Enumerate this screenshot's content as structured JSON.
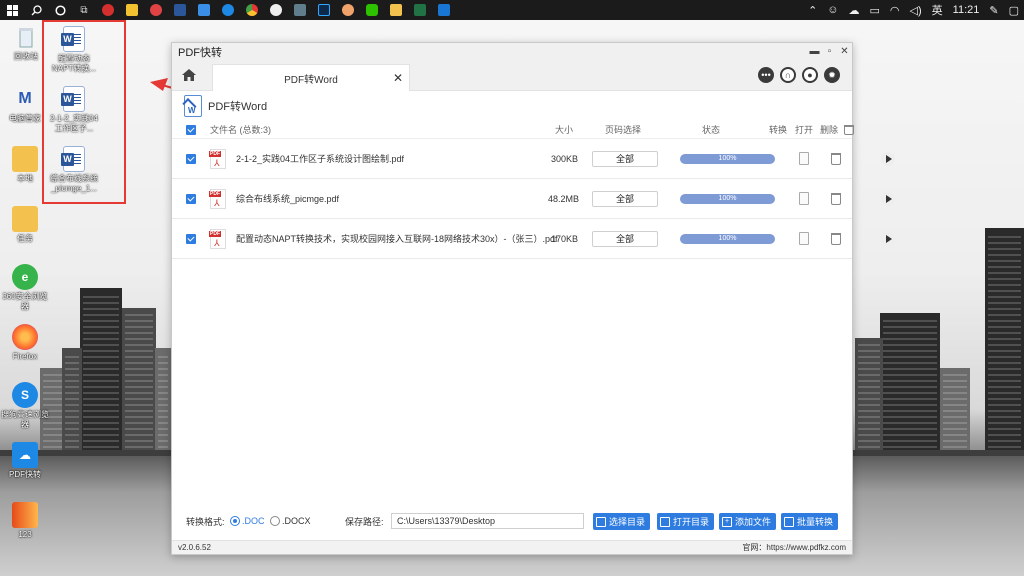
{
  "taskbar": {
    "right": {
      "lang": "英",
      "time": "11:21"
    }
  },
  "desktop_icons": [
    {
      "label": "回收站",
      "icon": "recycle-bin-icon"
    },
    {
      "label": "电脑管家",
      "icon": "pc-manager-icon"
    },
    {
      "label": "本地",
      "icon": "folder-icon"
    },
    {
      "label": "任务",
      "icon": "folder-icon"
    },
    {
      "label": "360安全浏览器",
      "icon": "browser-360-icon"
    },
    {
      "label": "Firefox",
      "icon": "firefox-icon"
    },
    {
      "label": "搜狗高速浏览器",
      "icon": "sogou-browser-icon"
    },
    {
      "label": "PDF快转",
      "icon": "cloud-pdf-icon"
    },
    {
      "label": "123",
      "icon": "folder-icon"
    }
  ],
  "desktop_files": [
    {
      "label": "配置动态NAPT转换..."
    },
    {
      "label": "2-1-2_实践04工作区子..."
    },
    {
      "label": "综合布线系统_picmge_1..."
    }
  ],
  "window": {
    "title": "PDF快转",
    "tab_label": "PDF转Word",
    "section_title": "PDF转Word",
    "columns": {
      "filename": "文件名 (总数:3)",
      "size": "大小",
      "pages": "页码选择",
      "status": "状态",
      "convert": "转换",
      "open": "打开",
      "delete": "删除"
    },
    "files": [
      {
        "name": "2-1-2_实践04工作区子系统设计图绘制.pdf",
        "size": "300KB",
        "pages": "全部",
        "progress_label": "100%",
        "progress": 100
      },
      {
        "name": "综合布线系统_picmge.pdf",
        "size": "48.2MB",
        "pages": "全部",
        "progress_label": "100%",
        "progress": 100
      },
      {
        "name": "配置动态NAPT转换技术，实现校园网接入互联网-18网络技术30x）-（张三）.pdf",
        "size": "170KB",
        "pages": "全部",
        "progress_label": "100%",
        "progress": 100
      }
    ],
    "bottom": {
      "format_label": "转换格式:",
      "format_doc": ".DOC",
      "format_docx": ".DOCX",
      "path_label": "保存路径:",
      "path_value": "C:\\Users\\13379\\Desktop",
      "btn_select_dir": "选择目录",
      "btn_open_dir": "打开目录",
      "btn_add_file": "添加文件",
      "btn_batch": "批量转换"
    },
    "status": {
      "version": "v2.0.6.52",
      "website": "官网：https://www.pdfkz.com"
    }
  },
  "colors": {
    "accent": "#2f7ce0",
    "annotation": "#e53935",
    "taskbar": "#1b1b1b"
  }
}
